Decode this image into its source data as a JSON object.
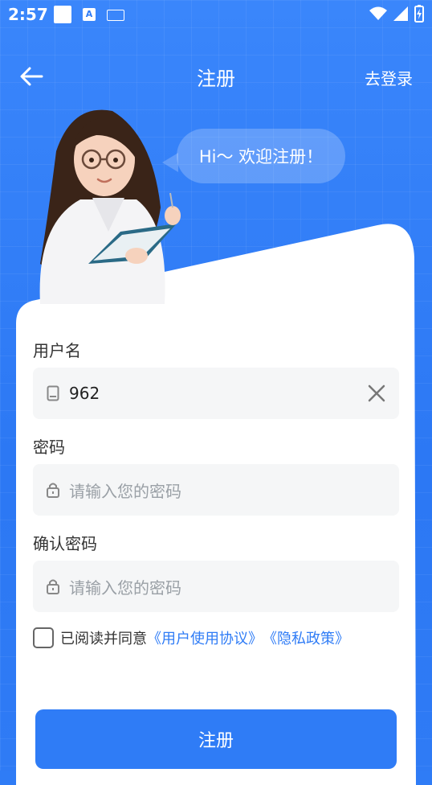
{
  "status_bar": {
    "time": "2:57",
    "a_icon": "A"
  },
  "header": {
    "title": "注册",
    "login_link": "去登录"
  },
  "bubble": {
    "text": "Hi～ 欢迎注册！"
  },
  "form": {
    "username": {
      "label": "用户名",
      "value": "962"
    },
    "password": {
      "label": "密码",
      "placeholder": "请输入您的密码"
    },
    "confirm": {
      "label": "确认密码",
      "placeholder": "请输入您的密码"
    }
  },
  "agreement": {
    "prefix": "已阅读并同意",
    "user_agreement": "《用户使用协议》",
    "privacy_policy": "《隐私政策》"
  },
  "submit_label": "注册",
  "colors": {
    "primary": "#2f7cf6",
    "field_bg": "#f5f6f7"
  }
}
